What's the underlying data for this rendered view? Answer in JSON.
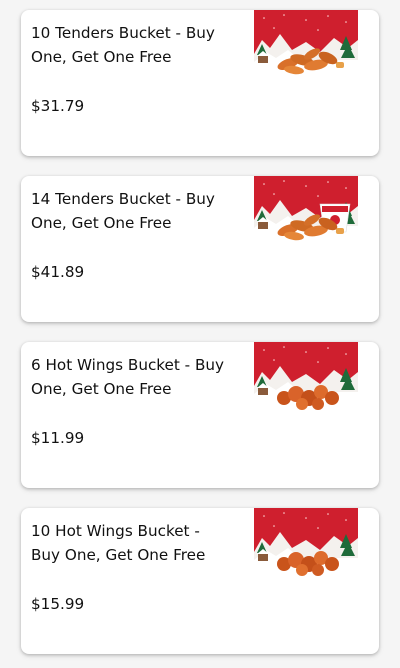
{
  "menu_items": [
    {
      "title": "10 Tenders Bucket - Buy One, Get One Free",
      "price": "$31.79",
      "image": "tenders-bucket-image"
    },
    {
      "title": "14 Tenders Bucket - Buy One, Get One Free",
      "price": "$41.89",
      "image": "tenders-bucket-image"
    },
    {
      "title": "6 Hot Wings Bucket - Buy One, Get One Free",
      "price": "$11.99",
      "image": "hot-wings-bucket-image"
    },
    {
      "title": "10 Hot Wings Bucket - Buy One, Get One Free",
      "price": "$15.99",
      "image": "hot-wings-bucket-image"
    }
  ],
  "colors": {
    "background": "#f5f5f5",
    "card": "#ffffff",
    "text": "#111111",
    "image_red": "#cf1f2e",
    "chicken": "#d9702a"
  }
}
